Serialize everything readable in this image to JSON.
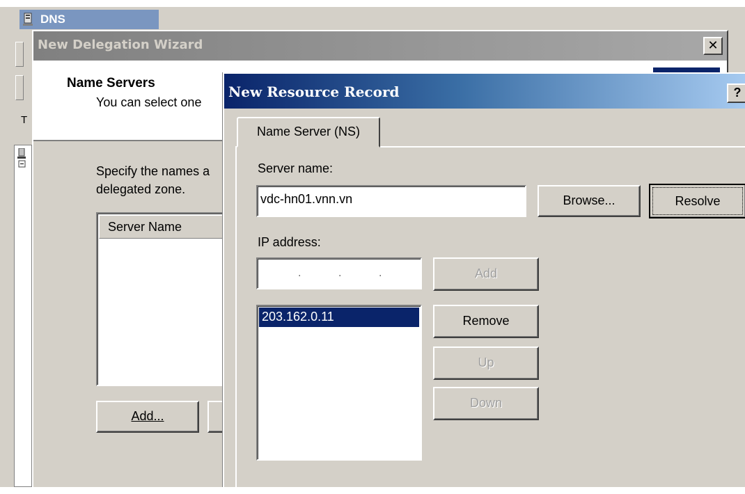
{
  "dns_console": {
    "title": "DNS",
    "tree_letter": "T"
  },
  "wizard": {
    "title": "New Delegation Wizard",
    "close_glyph": "✕",
    "header_title": "Name Servers",
    "header_subtitle": "You can select one",
    "instruction_line1": "Specify the names a",
    "instruction_line2": "delegated zone.",
    "list_column_header": "Server Name",
    "add_button_label": "Add..."
  },
  "resource_record": {
    "title": "New Resource Record",
    "help_glyph": "?",
    "tab_label": "Name Server (NS)",
    "server_name_label": "Server name:",
    "server_name_value": "vdc-hn01.vnn.vn",
    "browse_button_label": "Browse...",
    "resolve_button_label": "Resolve",
    "ip_address_label": "IP address:",
    "ip_separator": ".",
    "add_button_label": "Add",
    "ip_addresses": [
      "203.162.0.11"
    ],
    "remove_button_label": "Remove",
    "up_button_label": "Up",
    "down_button_label": "Down"
  },
  "colors": {
    "dialog_face": "#d4d0c8",
    "active_title_start": "#0a246a",
    "active_title_end": "#a6caf0",
    "inactive_title": "#808080",
    "selection": "#0a246a"
  },
  "icons": {
    "dns": "dns-server-icon",
    "close": "close-icon",
    "help": "help-icon"
  }
}
